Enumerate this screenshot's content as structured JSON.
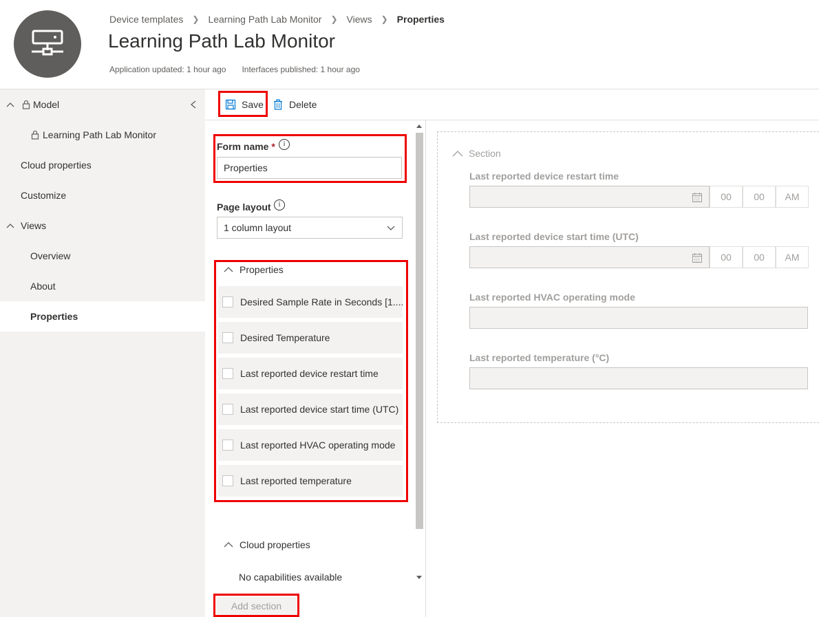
{
  "header": {
    "breadcrumbs": [
      "Device templates",
      "Learning Path Lab Monitor",
      "Views",
      "Properties"
    ],
    "title": "Learning Path Lab Monitor",
    "app_updated": "Application updated: 1 hour ago",
    "interfaces_published": "Interfaces published: 1 hour ago",
    "avatar_icon": "device-icon"
  },
  "sidebar": {
    "model": "Model",
    "model_child": "Learning Path Lab Monitor",
    "cloud_properties": "Cloud properties",
    "customize": "Customize",
    "views": "Views",
    "views_children": [
      "Overview",
      "About",
      "Properties"
    ],
    "selected": "Properties"
  },
  "toolbar": {
    "save_label": "Save",
    "delete_label": "Delete"
  },
  "form": {
    "form_name_label": "Form name",
    "form_name_required": "*",
    "form_name_value": "Properties",
    "page_layout_label": "Page layout",
    "page_layout_value": "1 column layout",
    "properties_section": "Properties",
    "properties_items": [
      "Desired Sample Rate in Seconds [1....",
      "Desired Temperature",
      "Last reported device restart time",
      "Last reported device start time (UTC)",
      "Last reported HVAC operating mode",
      "Last reported temperature"
    ],
    "cloud_section": "Cloud properties",
    "cloud_empty": "No capabilities available",
    "add_section_label": "Add section"
  },
  "preview": {
    "section_label": "Section",
    "fields": [
      {
        "label": "Last reported device restart time",
        "hour": "00",
        "minute": "00",
        "ampm": "AM"
      },
      {
        "label": "Last reported device start time (UTC)",
        "hour": "00",
        "minute": "00",
        "ampm": "AM"
      },
      {
        "label": "Last reported HVAC operating mode"
      },
      {
        "label": "Last reported temperature (°C)"
      }
    ]
  },
  "colors": {
    "accent": "#0078d4",
    "annotation_red": "#e00000",
    "sidebar_bg": "#f3f2f1"
  }
}
